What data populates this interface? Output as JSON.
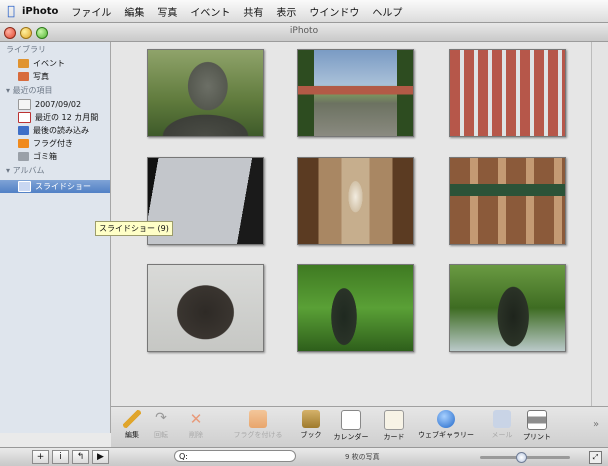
{
  "menubar": {
    "items": [
      "iPhoto",
      "ファイル",
      "編集",
      "写真",
      "イベント",
      "共有",
      "表示",
      "ウインドウ",
      "ヘルプ"
    ]
  },
  "window": {
    "title": "iPhoto"
  },
  "sidebar": {
    "library_header": "ライブラリ",
    "library": [
      {
        "label": "イベント",
        "icon": "events-icon"
      },
      {
        "label": "写真",
        "icon": "photos-icon"
      }
    ],
    "recent_header": "最近の項目",
    "recent": [
      {
        "label": "2007/09/02",
        "icon": "folder-icon"
      },
      {
        "label": "最近の 12 カ月間",
        "icon": "calendar-icon"
      },
      {
        "label": "最後の読み込み",
        "icon": "import-icon"
      },
      {
        "label": "フラグ付き",
        "icon": "flag-icon"
      },
      {
        "label": "ゴミ箱",
        "icon": "trash-icon"
      }
    ],
    "album_header": "アルバム",
    "album": [
      {
        "label": "スライドショー",
        "icon": "slideshow-icon",
        "selected": true
      }
    ]
  },
  "tooltip": "スライドショー (9)",
  "toolbar": [
    {
      "label": "編集",
      "icon": "pencil-icon",
      "enabled": true
    },
    {
      "label": "回転",
      "icon": "rotate-icon",
      "enabled": false
    },
    {
      "label": "削除",
      "icon": "delete-x-icon",
      "enabled": false
    },
    {
      "label": "フラグを付ける",
      "icon": "flag-icon",
      "enabled": false
    },
    {
      "label": "ブック",
      "icon": "book-icon",
      "enabled": true
    },
    {
      "label": "カレンダー",
      "icon": "calendar-icon",
      "enabled": true
    },
    {
      "label": "カード",
      "icon": "card-icon",
      "enabled": true
    },
    {
      "label": "ウェブギャラリー",
      "icon": "globe-icon",
      "enabled": true
    },
    {
      "label": "メール",
      "icon": "mail-icon",
      "enabled": false
    },
    {
      "label": "プリント",
      "icon": "printer-icon",
      "enabled": true
    }
  ],
  "bottom": {
    "buttons": [
      "+",
      "i",
      "↰",
      "▶"
    ],
    "search_prefix": "Q:",
    "count": "9 枚の写真",
    "zoom_fraction": 0.45,
    "full_screen": "⤢"
  },
  "colors": {
    "selection": "#5a86c8",
    "sidebar": "#dfe5ed"
  }
}
